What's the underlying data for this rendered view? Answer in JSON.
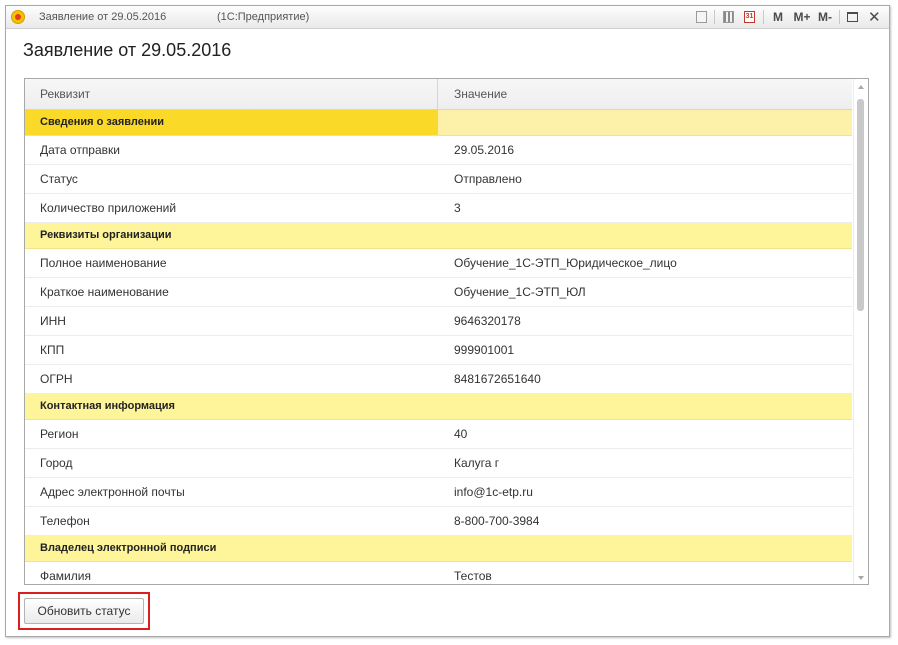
{
  "window": {
    "title": "Заявление от 29.05.2016",
    "app_name": "(1С:Предприятие)",
    "toolbar": {
      "m_label": "M",
      "m_plus_label": "M+",
      "m_minus_label": "M-",
      "calendar_day": "31"
    }
  },
  "form": {
    "heading": "Заявление от 29.05.2016"
  },
  "table": {
    "columns": [
      "Реквизит",
      "Значение"
    ],
    "rows": [
      {
        "type": "group",
        "label": "Сведения о заявлении",
        "value": ""
      },
      {
        "type": "data",
        "label": "Дата отправки",
        "value": "29.05.2016"
      },
      {
        "type": "data",
        "label": "Статус",
        "value": "Отправлено"
      },
      {
        "type": "data",
        "label": "Количество приложений",
        "value": "3"
      },
      {
        "type": "group",
        "label": "Реквизиты организации",
        "value": ""
      },
      {
        "type": "data",
        "label": "Полное наименование",
        "value": "Обучение_1С-ЭТП_Юридическое_лицо"
      },
      {
        "type": "data",
        "label": "Краткое наименование",
        "value": "Обучение_1С-ЭТП_ЮЛ"
      },
      {
        "type": "data",
        "label": "ИНН",
        "value": "9646320178"
      },
      {
        "type": "data",
        "label": "КПП",
        "value": "999901001"
      },
      {
        "type": "data",
        "label": "ОГРН",
        "value": "8481672651640"
      },
      {
        "type": "group",
        "label": "Контактная информация",
        "value": ""
      },
      {
        "type": "data",
        "label": "Регион",
        "value": "40"
      },
      {
        "type": "data",
        "label": "Город",
        "value": "Калуга г"
      },
      {
        "type": "data",
        "label": "Адрес электронной почты",
        "value": "info@1c-etp.ru"
      },
      {
        "type": "data",
        "label": "Телефон",
        "value": "8-800-700-3984"
      },
      {
        "type": "group",
        "label": "Владелец электронной подписи",
        "value": ""
      },
      {
        "type": "data",
        "label": "Фамилия",
        "value": "Тестов"
      }
    ]
  },
  "buttons": {
    "refresh_status": "Обновить статус"
  },
  "colors": {
    "group_row": "#fef59b",
    "selected_group_cell": "#fad928",
    "highlight_border": "#d92020"
  }
}
